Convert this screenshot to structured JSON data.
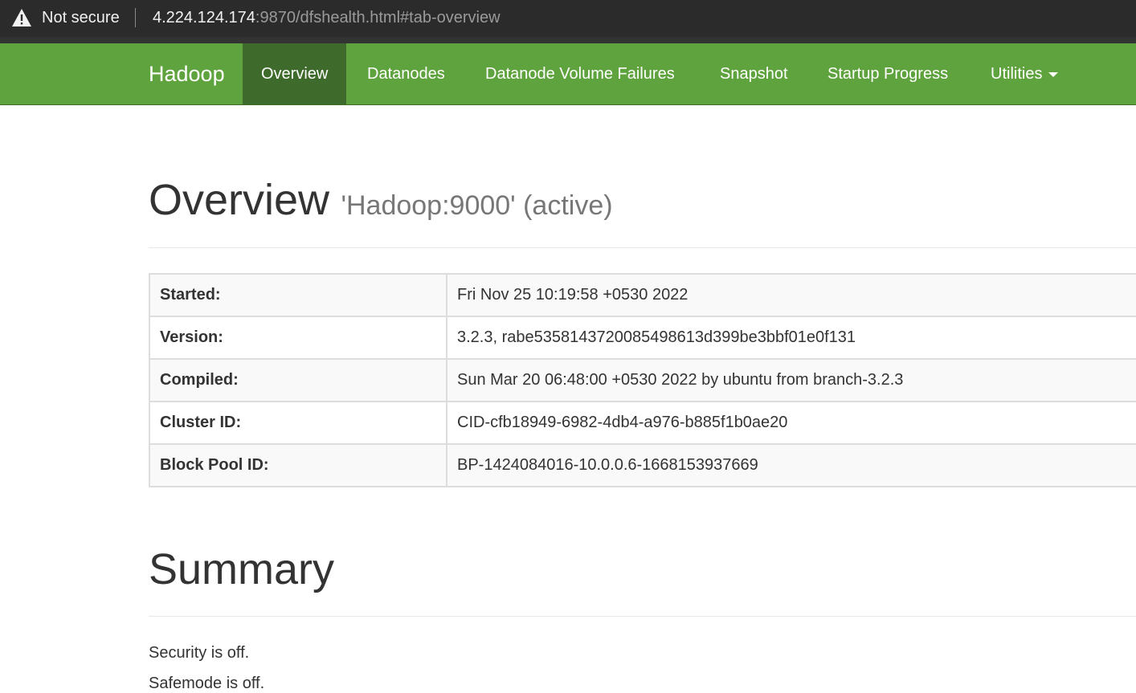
{
  "browser": {
    "security_label": "Not secure",
    "url_host": "4.224.124.174",
    "url_rest": ":9870/dfshealth.html#tab-overview"
  },
  "navbar": {
    "brand": "Hadoop",
    "items": [
      {
        "label": "Overview",
        "active": true
      },
      {
        "label": "Datanodes"
      },
      {
        "label": "Datanode Volume Failures"
      },
      {
        "label": "Snapshot"
      },
      {
        "label": "Startup Progress"
      },
      {
        "label": "Utilities"
      }
    ],
    "colors": {
      "bar": "#5fa33e",
      "active": "#3e6b2c"
    }
  },
  "overview": {
    "title": "Overview",
    "subtitle": "'Hadoop:9000' (active)",
    "rows": [
      {
        "label": "Started:",
        "value": "Fri Nov 25 10:19:58 +0530 2022"
      },
      {
        "label": "Version:",
        "value": "3.2.3, rabe5358143720085498613d399be3bbf01e0f131"
      },
      {
        "label": "Compiled:",
        "value": "Sun Mar 20 06:48:00 +0530 2022 by ubuntu from branch-3.2.3"
      },
      {
        "label": "Cluster ID:",
        "value": "CID-cfb18949-6982-4db4-a976-b885f1b0ae20"
      },
      {
        "label": "Block Pool ID:",
        "value": "BP-1424084016-10.0.0.6-1668153937669"
      }
    ]
  },
  "summary": {
    "title": "Summary",
    "lines": [
      "Security is off.",
      "Safemode is off."
    ]
  }
}
